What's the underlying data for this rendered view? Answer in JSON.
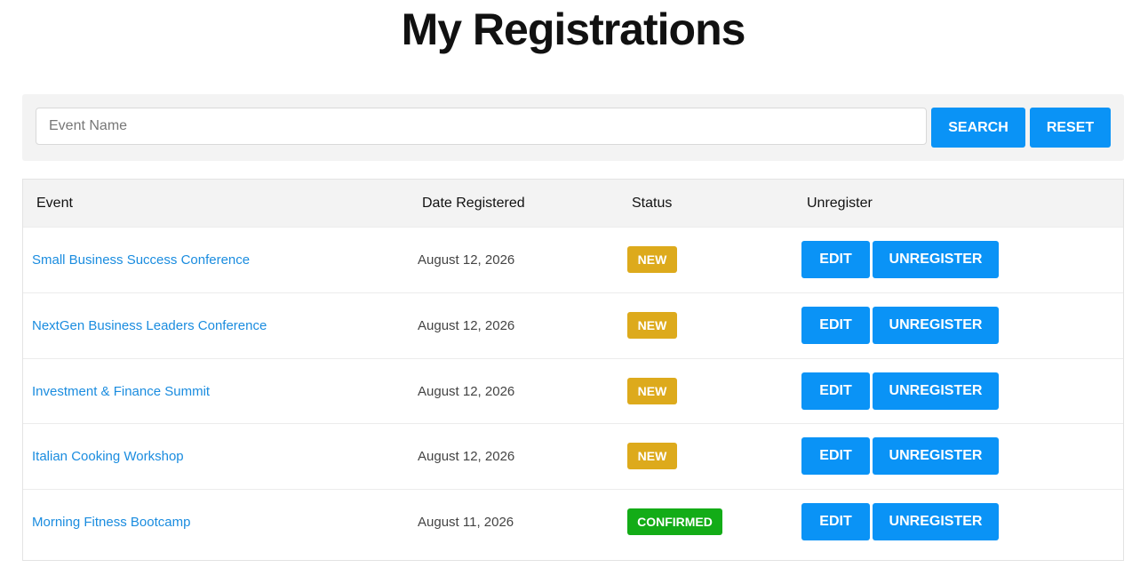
{
  "page": {
    "title": "My Registrations"
  },
  "search": {
    "placeholder": "Event Name",
    "value": "",
    "search_label": "SEARCH",
    "reset_label": "RESET"
  },
  "table": {
    "headers": {
      "event": "Event",
      "date": "Date Registered",
      "status": "Status",
      "unregister": "Unregister"
    },
    "rows": [
      {
        "event": "Small Business Success Conference",
        "date": "August 12, 2026",
        "status": "NEW",
        "edit": "EDIT",
        "unregister": "UNREGISTER"
      },
      {
        "event": "NextGen Business Leaders Conference",
        "date": "August 12, 2026",
        "status": "NEW",
        "edit": "EDIT",
        "unregister": "UNREGISTER"
      },
      {
        "event": "Investment & Finance Summit",
        "date": "August 12, 2026",
        "status": "NEW",
        "edit": "EDIT",
        "unregister": "UNREGISTER"
      },
      {
        "event": "Italian Cooking Workshop",
        "date": "August 12, 2026",
        "status": "NEW",
        "edit": "EDIT",
        "unregister": "UNREGISTER"
      },
      {
        "event": "Morning Fitness Bootcamp",
        "date": "August 11, 2026",
        "status": "CONFIRMED",
        "edit": "EDIT",
        "unregister": "UNREGISTER"
      }
    ]
  },
  "colors": {
    "accent": "#0a93f6",
    "link": "#1a8cdf",
    "status_new": "#ddaa1c",
    "status_confirmed": "#13ac17"
  }
}
